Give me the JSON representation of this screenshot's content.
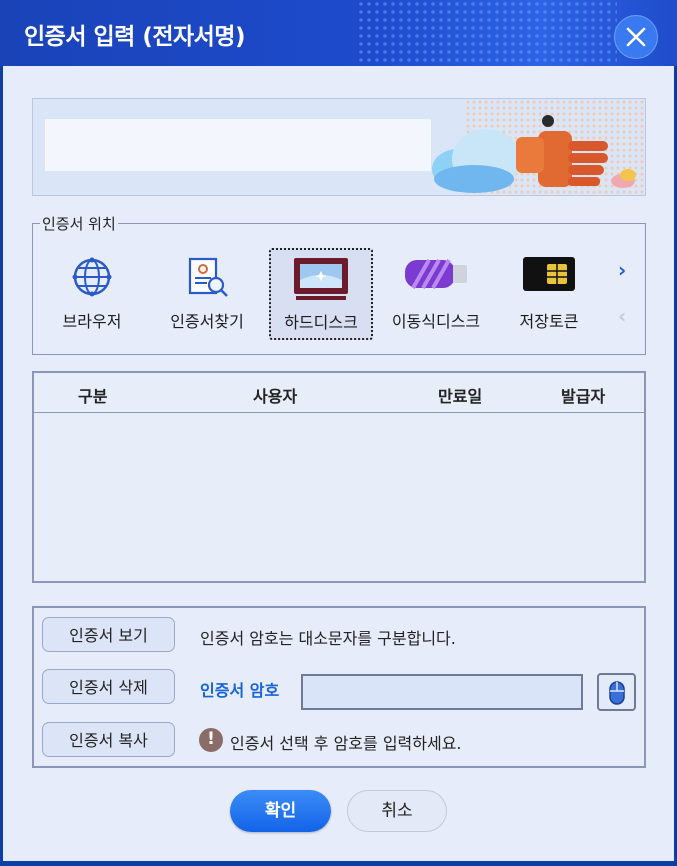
{
  "window": {
    "title": "인증서 입력 (전자서명)",
    "close_icon": "close-icon"
  },
  "colors": {
    "titlebar": "#1d4bcc",
    "accent": "#1763d8",
    "ok_button": "#1364e8",
    "background": "#e6ecf9"
  },
  "location": {
    "legend": "인증서 위치",
    "items": [
      {
        "label": "브라우저",
        "icon": "globe-icon",
        "selected": false
      },
      {
        "label": "인증서찾기",
        "icon": "certificate-search-icon",
        "selected": false
      },
      {
        "label": "하드디스크",
        "icon": "monitor-icon",
        "selected": true
      },
      {
        "label": "이동식디스크",
        "icon": "usb-drive-icon",
        "selected": false
      },
      {
        "label": "저장토큰",
        "icon": "smartcard-icon",
        "selected": false
      }
    ],
    "next_icon": "chevron-right-icon",
    "prev_icon": "chevron-left-icon"
  },
  "table": {
    "columns": [
      "구분",
      "사용자",
      "만료일",
      "발급자"
    ],
    "rows": []
  },
  "actions": {
    "view": "인증서 보기",
    "delete": "인증서 삭제",
    "copy": "인증서 복사"
  },
  "password": {
    "notice": "인증서 암호는 대소문자를 구분합니다.",
    "label": "인증서 암호",
    "value": "",
    "mouse_icon": "mouse-icon",
    "warning_icon": "exclamation-icon",
    "warning": "인증서 선택 후 암호를 입력하세요."
  },
  "buttons": {
    "ok": "확인",
    "cancel": "취소"
  }
}
